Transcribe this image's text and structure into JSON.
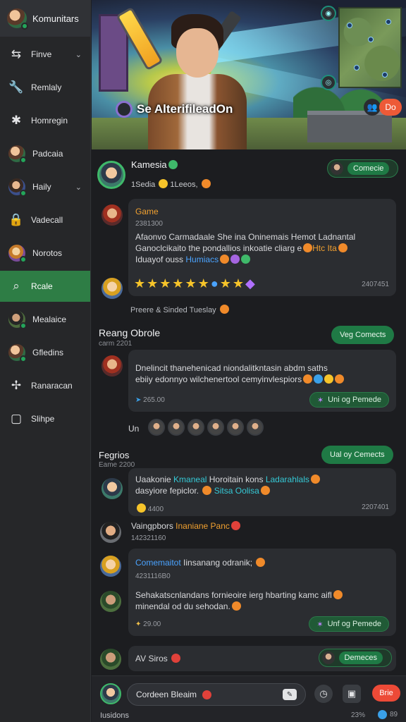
{
  "sidebar": {
    "header_title": "Komunitars",
    "items": [
      {
        "label": "Finve",
        "icon": "shuffle-icon",
        "chevron": true
      },
      {
        "label": "Remlaly",
        "icon": "wrench-icon"
      },
      {
        "label": "Homregin",
        "icon": "puzzle-icon"
      },
      {
        "label": "Padcaia",
        "icon": "avatar-icon"
      },
      {
        "label": "Haily",
        "icon": "avatar-icon",
        "chevron": true
      },
      {
        "label": "Vadecall",
        "icon": "lock-icon"
      },
      {
        "label": "Norotos",
        "icon": "avatar-icon"
      },
      {
        "label": "Rcale",
        "icon": "search-icon",
        "active": true
      },
      {
        "label": "Mealaice",
        "icon": "avatar-icon"
      },
      {
        "label": "Gfledins",
        "icon": "avatar-icon"
      },
      {
        "label": "Ranaracan",
        "icon": "pin-icon"
      },
      {
        "label": "Slihpe",
        "icon": "square-icon"
      }
    ]
  },
  "banner": {
    "label": "Se AlterifileadOn",
    "button_red": "Do"
  },
  "feed": {
    "top_post": {
      "author": "Kamesia",
      "sub": "1Sedia",
      "sub2": "1Leeos,",
      "pill": "Comecie"
    },
    "game_card": {
      "title": "Game",
      "date": "2381300",
      "line1": "Afaonvo Carmadaale She ina Oninemais Hemot Ladnantal",
      "line2": "Ganoclcikaito the pondallios inkoatie cliarg e",
      "line2_hl": "Htc Ita",
      "line3": "Iduayof ouss",
      "line3_hl": "Humiacs",
      "timestamp": "2407451",
      "footer": "Preere & Sinded Tueslay"
    },
    "section1": {
      "title": "Reang Obrole",
      "sub": "carm 2201",
      "pill": "Veg Comects",
      "line1": "Dnelincit thanehenicad niondalitkntasin abdm saths",
      "line2": "ebiiy edonnyo wilchenertool cemyinvlespiors",
      "count": "265.00",
      "action": "Uni og Pemede",
      "react_label": "Un"
    },
    "section2": {
      "title": "Fegrios",
      "sub": "Eame 2200",
      "pill": "Ual oy Cemects",
      "line1_a": "Uaakonie",
      "line1_hl": "Kmaneal",
      "line1_b": "Horoitain kons",
      "line1_hl2": "Ladarahlals",
      "line2_a": "dasyiore fepiclor.",
      "line2_hl": "Sitsa Oolisa",
      "count": "4400",
      "timestamp": "2207401",
      "reply_author": "Vaingpbors",
      "reply_hl": "Inaniane Panc",
      "reply_date": "142321160",
      "nested_title_hl": "Comemaitot",
      "nested_title": "Iinsanang odranik;",
      "nested_date": "4231116B0",
      "nested_line1": "Sehakatscnlandans fornieoire ierg hbarting kamc aifl",
      "nested_line2": "minendal od du sehodan.",
      "nested_count": "29.00",
      "nested_action": "Unf og Pemede",
      "last_author": "AV Siros",
      "last_pill": "Demeces"
    }
  },
  "composer": {
    "input_value": "Cordeen Bleaim",
    "send_label": "Brie",
    "bottom_left": "Iusidons",
    "bottom_pct": "23%",
    "bottom_num": "89"
  }
}
